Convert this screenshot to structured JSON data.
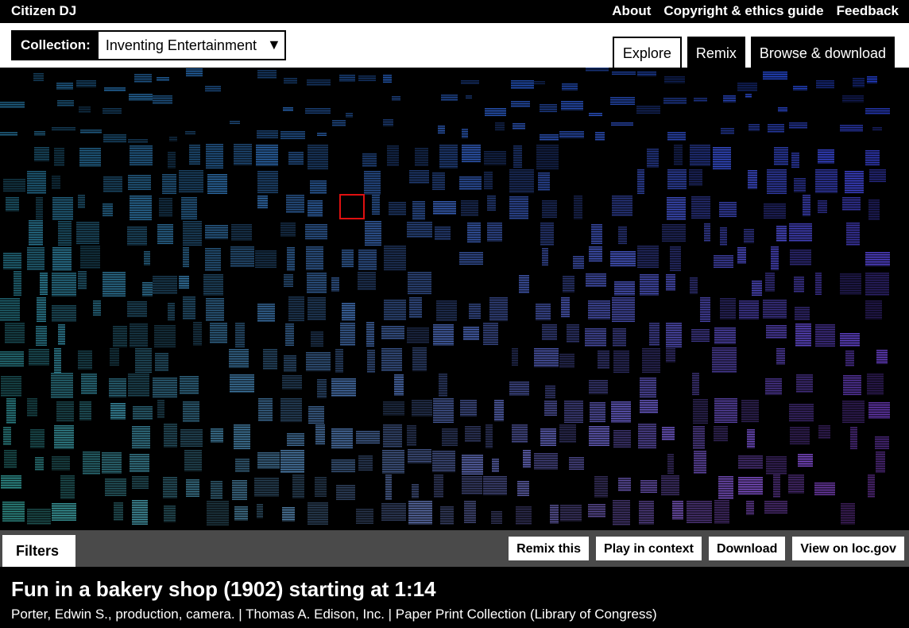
{
  "header": {
    "brand": "Citizen DJ",
    "nav": [
      "About",
      "Copyright & ethics guide",
      "Feedback"
    ]
  },
  "collection": {
    "label": "Collection:",
    "selected": "Inventing Entertainment",
    "arrow": "▼"
  },
  "tabs": [
    {
      "label": "Explore",
      "active": true
    },
    {
      "label": "Remix",
      "active": false
    },
    {
      "label": "Browse & download",
      "active": false
    }
  ],
  "toolbar": {
    "filters_label": "Filters",
    "actions": [
      "Remix this",
      "Play in context",
      "Download",
      "View on loc.gov"
    ]
  },
  "clip": {
    "title": "Fun in a bakery shop (1902) starting at 1:14",
    "meta": "Porter, Edwin S., production, camera. | Thomas A. Edison, Inc. | Paper Print Collection (Library of Congress)"
  },
  "colors": {
    "accent_selected": "#e01010",
    "toolbar_bg": "#4a4a4a"
  }
}
